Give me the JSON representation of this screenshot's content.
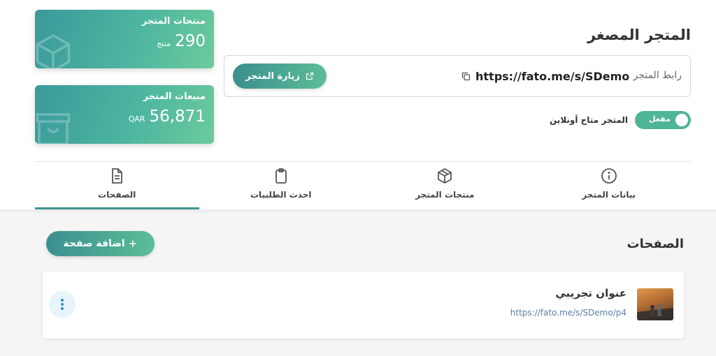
{
  "stats": {
    "products": {
      "title": "منتجات المتجر",
      "value": "290",
      "unit": "منتج"
    },
    "sales": {
      "title": "مبيعات المتجر",
      "value": "56,871",
      "unit": "QAR"
    }
  },
  "store": {
    "title": "المتجر المصغر",
    "url_label": "رابط المتجر",
    "url": "https://fato.me/s/SDemo",
    "visit_button": "زيارة المتجر",
    "online_label": "المتجر متاح أونلاين",
    "toggle_label": "مفعل",
    "toggle_on": true
  },
  "tabs": [
    {
      "label": "بيانات المتجر",
      "icon": "info-icon",
      "active": false
    },
    {
      "label": "منتجات المتجر",
      "icon": "box-icon",
      "active": false
    },
    {
      "label": "احدث الطلبيات",
      "icon": "clipboard-icon",
      "active": false
    },
    {
      "label": "الصفحات",
      "icon": "document-icon",
      "active": true
    }
  ],
  "pages_section": {
    "title": "الصفحات",
    "add_button": "اضافة صفحة",
    "items": [
      {
        "name": "عنوان تجريبي",
        "url": "https://fato.me/s/SDemo/p4"
      }
    ]
  },
  "colors": {
    "accent": "#4db5a0",
    "accent_dark": "#3b8f8f",
    "link": "#5a7fa8"
  }
}
